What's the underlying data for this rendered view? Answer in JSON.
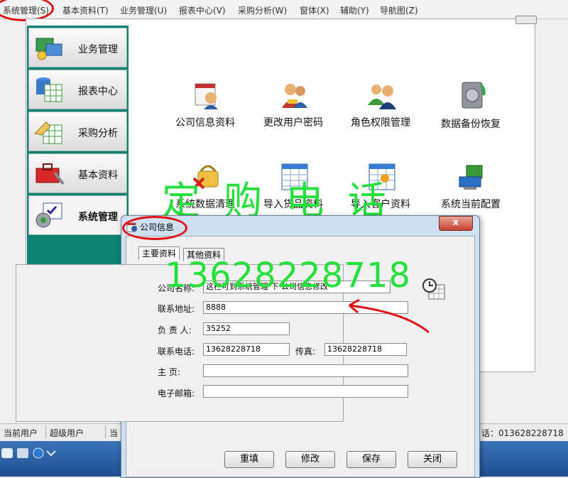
{
  "menu": {
    "items": [
      "系统管理(S)",
      "基本资料(T)",
      "业务管理(U)",
      "报表中心(V)",
      "采购分析(W)",
      "窗体(X)",
      "辅助(Y)",
      "导航图(Z)"
    ]
  },
  "sidebar": {
    "items": [
      {
        "label": "业务管理"
      },
      {
        "label": "报表中心"
      },
      {
        "label": "采购分析"
      },
      {
        "label": "基本资料"
      },
      {
        "label": "系统管理"
      }
    ]
  },
  "tools": {
    "items": [
      {
        "label": "公司信息资料",
        "icon": "company-info-icon"
      },
      {
        "label": "更改用户密码",
        "icon": "change-password-icon"
      },
      {
        "label": "角色权限管理",
        "icon": "role-permission-icon"
      },
      {
        "label": "数据备份恢复",
        "icon": "backup-icon"
      },
      {
        "label": "系统数据清理",
        "icon": "data-clean-icon"
      },
      {
        "label": "导入货品资料",
        "icon": "import-goods-icon"
      },
      {
        "label": "导入客户资料",
        "icon": "import-customer-icon"
      },
      {
        "label": "系统当前配置",
        "icon": "system-config-icon"
      }
    ]
  },
  "watermark": {
    "line1": "定 购 电 话",
    "line2": "13628228718"
  },
  "status": {
    "user_label": "当前用户",
    "user_value": "超级用户",
    "cell3": "当",
    "phone": "话：013628228718"
  },
  "dialog": {
    "title": "公司信息",
    "close": "x",
    "tabs": [
      "主要资料",
      "其他资料"
    ],
    "fields": {
      "company_label": "公司名称:",
      "company_value": "这栏可到系统管理 下 公司信息修改",
      "address_label": "联系地址:",
      "address_value": "8888",
      "manager_label": "负 责 人:",
      "manager_value": "35252",
      "phone_label": "联系电话:",
      "phone_value": "13628228718",
      "fax_label": "传真:",
      "fax_value": "13628228718",
      "homepage_label": "主     页:",
      "homepage_value": "",
      "email_label": "电子邮箱:",
      "email_value": ""
    },
    "buttons": {
      "reset": "重填",
      "edit": "修改",
      "save": "保存",
      "close": "关闭"
    }
  },
  "colors": {
    "sidebar_bg": "#0d8374",
    "watermark": "#24e03b",
    "annotation": "#e01010",
    "taskbar": "#2a5ea3"
  }
}
